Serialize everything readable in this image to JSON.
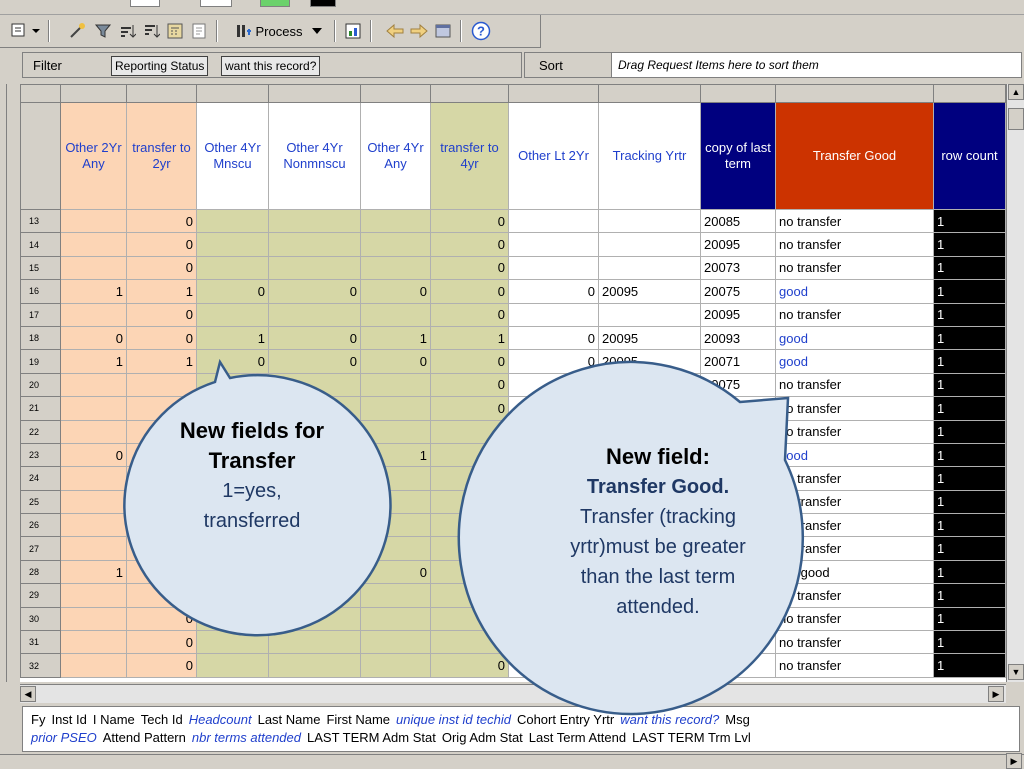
{
  "toolbar": {
    "process_label": "Process",
    "help_icon": "help-icon"
  },
  "filter_band": {
    "filter_label": "Filter",
    "filter_items": [
      "Reporting Status",
      "want this record?"
    ],
    "sort_label": "Sort",
    "sort_placeholder": "Drag Request Items here to sort them"
  },
  "grid": {
    "columns": [
      "Other 2Yr Any",
      "transfer to 2yr",
      "Other 4Yr Mnscu",
      "Other 4Yr Nonmnscu",
      "Other 4Yr Any",
      "transfer to 4yr",
      "Other Lt 2Yr",
      "Tracking Yrtr",
      "copy of last term",
      "Transfer Good",
      "row count"
    ],
    "rows": [
      {
        "n": "13",
        "c": [
          "",
          "0",
          "",
          "",
          "",
          "0",
          "",
          "",
          "20085",
          "no transfer",
          "1"
        ]
      },
      {
        "n": "14",
        "c": [
          "",
          "0",
          "",
          "",
          "",
          "0",
          "",
          "",
          "20095",
          "no transfer",
          "1"
        ]
      },
      {
        "n": "15",
        "c": [
          "",
          "0",
          "",
          "",
          "",
          "0",
          "",
          "",
          "20073",
          "no transfer",
          "1"
        ]
      },
      {
        "n": "16",
        "c": [
          "1",
          "1",
          "0",
          "0",
          "0",
          "0",
          "0",
          "20095",
          "20075",
          "good",
          "1"
        ]
      },
      {
        "n": "17",
        "c": [
          "",
          "0",
          "",
          "",
          "",
          "0",
          "",
          "",
          "20095",
          "no transfer",
          "1"
        ]
      },
      {
        "n": "18",
        "c": [
          "0",
          "0",
          "1",
          "0",
          "1",
          "1",
          "0",
          "20095",
          "20093",
          "good",
          "1"
        ]
      },
      {
        "n": "19",
        "c": [
          "1",
          "1",
          "0",
          "0",
          "0",
          "0",
          "0",
          "20095",
          "20071",
          "good",
          "1"
        ]
      },
      {
        "n": "20",
        "c": [
          "",
          "",
          "",
          "",
          "",
          "0",
          "",
          "",
          "20075",
          "no transfer",
          "1"
        ]
      },
      {
        "n": "21",
        "c": [
          "",
          "",
          "",
          "",
          "",
          "0",
          "",
          "",
          "",
          "no transfer",
          "1"
        ]
      },
      {
        "n": "22",
        "c": [
          "",
          "",
          "",
          "",
          "",
          "0",
          "",
          "",
          "",
          "no transfer",
          "1"
        ]
      },
      {
        "n": "23",
        "c": [
          "0",
          "",
          "",
          "",
          "1",
          "1",
          "",
          "",
          "",
          "good",
          "1"
        ]
      },
      {
        "n": "24",
        "c": [
          "",
          "",
          "",
          "",
          "",
          "",
          "",
          "",
          "",
          "no transfer",
          "1"
        ]
      },
      {
        "n": "25",
        "c": [
          "",
          "",
          "",
          "",
          "",
          "",
          "",
          "",
          "",
          "no transfer",
          "1"
        ]
      },
      {
        "n": "26",
        "c": [
          "",
          "",
          "",
          "",
          "",
          "",
          "",
          "",
          "",
          "no transfer",
          "1"
        ]
      },
      {
        "n": "27",
        "c": [
          "",
          "",
          "",
          "",
          "",
          "",
          "",
          "",
          "",
          "no transfer",
          "1"
        ]
      },
      {
        "n": "28",
        "c": [
          "1",
          "",
          "",
          "0",
          "0",
          "",
          "",
          "",
          "",
          "not good",
          "1"
        ]
      },
      {
        "n": "29",
        "c": [
          "",
          "0",
          "",
          "",
          "",
          "0",
          "",
          "",
          "",
          "no transfer",
          "1"
        ]
      },
      {
        "n": "30",
        "c": [
          "",
          "0",
          "",
          "",
          "",
          "0",
          "",
          "",
          "",
          "no transfer",
          "1"
        ]
      },
      {
        "n": "31",
        "c": [
          "",
          "0",
          "",
          "",
          "",
          "0",
          "",
          "",
          "",
          "no transfer",
          "1"
        ]
      },
      {
        "n": "32",
        "c": [
          "",
          "0",
          "",
          "",
          "",
          "0",
          "",
          "",
          "20075",
          "no transfer",
          "1"
        ]
      }
    ]
  },
  "fields_panel": {
    "line1": [
      {
        "t": "Fy",
        "i": false
      },
      {
        "t": "Inst Id",
        "i": false
      },
      {
        "t": "I Name",
        "i": false
      },
      {
        "t": "Tech Id",
        "i": false
      },
      {
        "t": "Headcount",
        "i": true
      },
      {
        "t": "Last Name",
        "i": false
      },
      {
        "t": "First Name",
        "i": false
      },
      {
        "t": "unique inst id techid",
        "i": true
      },
      {
        "t": "Cohort Entry Yrtr",
        "i": false
      },
      {
        "t": "want this record?",
        "i": true
      },
      {
        "t": "Msg",
        "i": false
      }
    ],
    "line2": [
      {
        "t": "prior PSEO",
        "i": true
      },
      {
        "t": "Attend Pattern",
        "i": false
      },
      {
        "t": "nbr terms attended",
        "i": true
      },
      {
        "t": "LAST TERM Adm Stat",
        "i": false
      },
      {
        "t": "Orig Adm Stat",
        "i": false
      },
      {
        "t": "Last Term Attend",
        "i": false
      },
      {
        "t": "LAST TERM Trm Lvl",
        "i": false
      }
    ]
  },
  "callout_left": {
    "title": "New fields for Transfer",
    "line1": "1=yes,",
    "line2": "transferred"
  },
  "callout_right": {
    "title": "New field:",
    "subtitle": "Transfer Good.",
    "line1": "Transfer (tracking",
    "line2": "yrtr)must be greater",
    "line3": "than the last term",
    "line4": "attended."
  },
  "colors": {
    "peach": "#fcd5b5",
    "olive": "#d6d7a6",
    "navy": "#00007f",
    "red": "#cc3300",
    "link_blue": "#1f3fcc",
    "bubble_fill": "#dce6f1",
    "bubble_stroke": "#385d8a"
  }
}
